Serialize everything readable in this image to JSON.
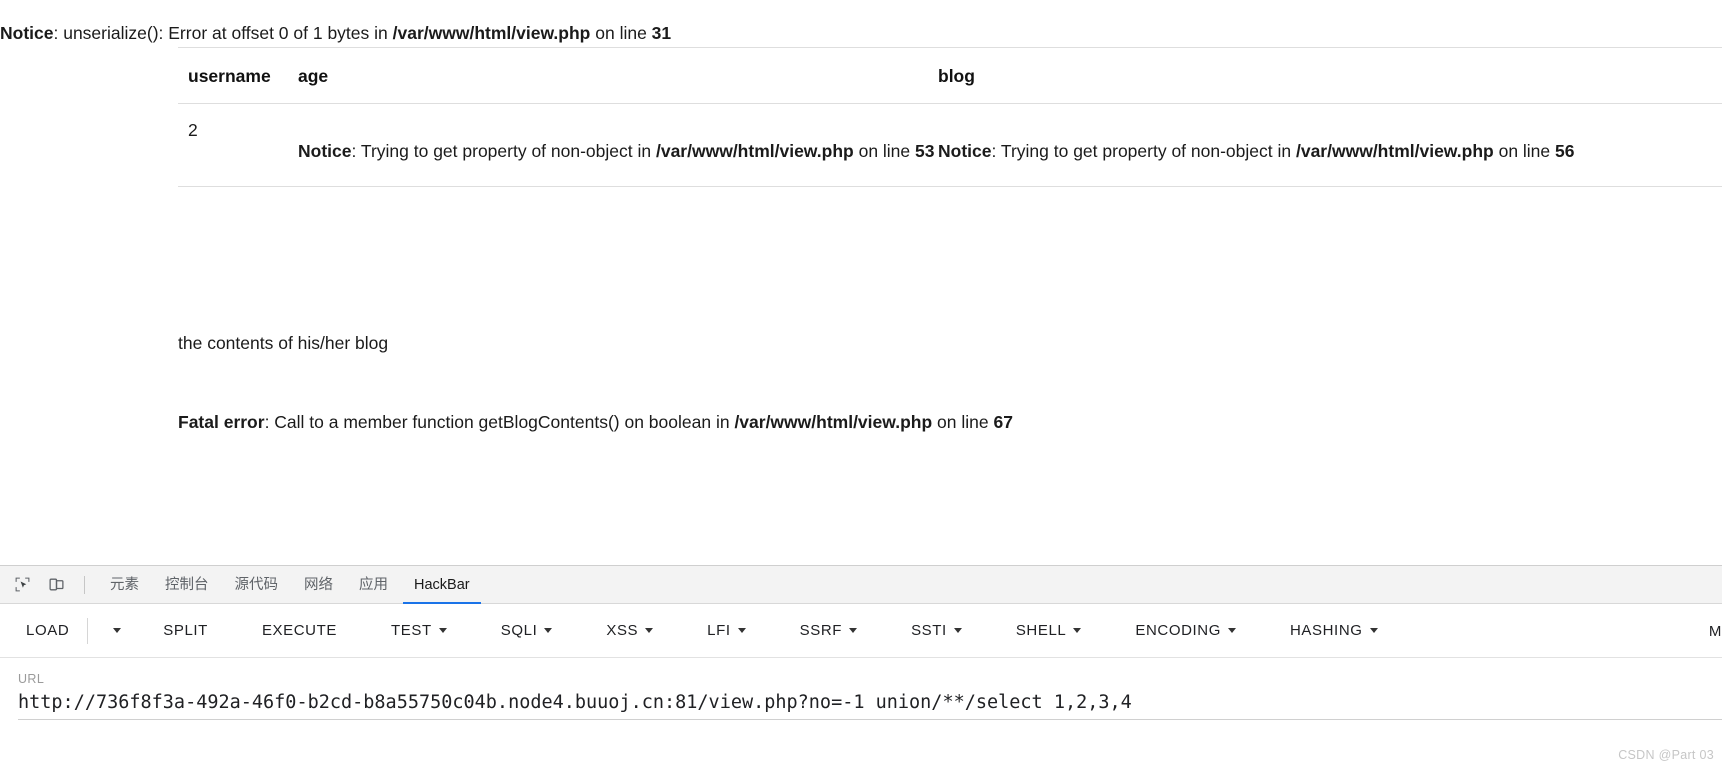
{
  "page": {
    "top_notice": {
      "label": "Notice",
      "sep": ": ",
      "message": "unserialize(): Error at offset 0 of 1 bytes in ",
      "file": "/var/www/html/view.php",
      "on_line": " on line ",
      "line": "31"
    },
    "table": {
      "headers": [
        "username",
        "age",
        "blog"
      ],
      "rows": [
        {
          "username": "2",
          "age_notice": {
            "label": "Notice",
            "sep": ": ",
            "message": "Trying to get property of non-object in ",
            "file": "/var/www/html/view.php",
            "on_line": " on line ",
            "line": "53"
          },
          "blog_notice": {
            "label": "Notice",
            "sep": ": ",
            "message": "Trying to get property of non-object in ",
            "file": "/var/www/html/view.php",
            "on_line": " on line ",
            "line": "56"
          }
        }
      ]
    },
    "blog_contents_text": "the contents of his/her blog",
    "fatal_error": {
      "label": "Fatal error",
      "sep": ": ",
      "message": "Call to a member function getBlogContents() on boolean in ",
      "file": "/var/www/html/view.php",
      "on_line": " on line ",
      "line": "67"
    }
  },
  "devtools": {
    "inspect_icon": "inspect-element-icon",
    "device_icon": "device-toolbar-icon",
    "tabs": [
      {
        "label": "元素",
        "active": false
      },
      {
        "label": "控制台",
        "active": false
      },
      {
        "label": "源代码",
        "active": false
      },
      {
        "label": "网络",
        "active": false
      },
      {
        "label": "应用",
        "active": false
      },
      {
        "label": "HackBar",
        "active": true
      }
    ]
  },
  "hackbar": {
    "buttons": [
      {
        "label": "LOAD",
        "caret": false
      },
      {
        "label": "SPLIT",
        "caret": false
      },
      {
        "label": "EXECUTE",
        "caret": false
      },
      {
        "label": "TEST",
        "caret": true
      },
      {
        "label": "SQLI",
        "caret": true
      },
      {
        "label": "XSS",
        "caret": true
      },
      {
        "label": "LFI",
        "caret": true
      },
      {
        "label": "SSRF",
        "caret": true
      },
      {
        "label": "SSTI",
        "caret": true
      },
      {
        "label": "SHELL",
        "caret": true
      },
      {
        "label": "ENCODING",
        "caret": true
      },
      {
        "label": "HASHING",
        "caret": true
      }
    ],
    "load_caret": "▾",
    "overflow_label": "M",
    "url_label": "URL",
    "url_value": "http://736f8f3a-492a-46f0-b2cd-b8a55750c04b.node4.buuoj.cn:81/view.php?no=-1 union/**/select 1,2,3,4",
    "url_placeholder": "URL"
  },
  "watermark": "CSDN @Part 03",
  "colors": {
    "accent": "#1a73e8",
    "tab_inactive": "#5f6368",
    "text": "#202124",
    "border": "#dedede"
  }
}
